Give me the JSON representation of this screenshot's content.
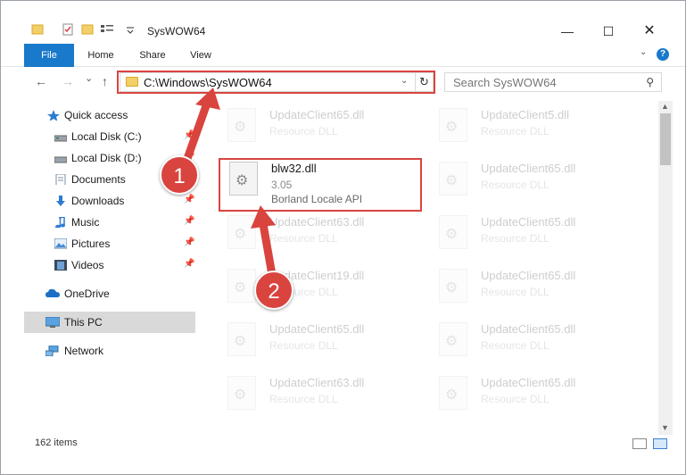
{
  "window": {
    "title": "SysWOW64",
    "minimize_glyph": "—",
    "maximize_glyph": "☐",
    "close_glyph": "✕"
  },
  "ribbon": {
    "tabs": [
      "File",
      "Home",
      "Share",
      "View"
    ],
    "help_glyph": "?"
  },
  "navigation": {
    "back_glyph": "←",
    "forward_glyph": "→",
    "recent_glyph": "⌄",
    "up_glyph": "↑",
    "address": "C:\\Windows\\SysWOW64",
    "search_placeholder": "Search SysWOW64"
  },
  "sidebar": {
    "items": [
      {
        "label": "Quick access",
        "icon": "star-icon",
        "pinned": false
      },
      {
        "label": "Local Disk (C:)",
        "icon": "drive-icon",
        "pinned": true
      },
      {
        "label": "Local Disk (D:)",
        "icon": "drive-icon",
        "pinned": true
      },
      {
        "label": "Documents",
        "icon": "documents-icon",
        "pinned": true
      },
      {
        "label": "Downloads",
        "icon": "download-icon",
        "pinned": true
      },
      {
        "label": "Music",
        "icon": "music-icon",
        "pinned": true
      },
      {
        "label": "Pictures",
        "icon": "pictures-icon",
        "pinned": true
      },
      {
        "label": "Videos",
        "icon": "videos-icon",
        "pinned": true
      },
      {
        "label": "OneDrive",
        "icon": "cloud-icon",
        "pinned": false
      },
      {
        "label": "This PC",
        "icon": "computer-icon",
        "pinned": false,
        "selected": true
      },
      {
        "label": "Network",
        "icon": "network-icon",
        "pinned": false
      }
    ]
  },
  "files": {
    "left_column": [
      {
        "name": "UpdateClient65.dll",
        "line2": "Resource DLL",
        "faded": true
      },
      {
        "name": "blw32.dll",
        "line2": "3.05",
        "line3": "Borland Locale API",
        "faded": false
      },
      {
        "name": "UpdateClient63.dll",
        "line2": "Resource DLL",
        "faded": true
      },
      {
        "name": "UpdateClient19.dll",
        "line2": "Resource DLL",
        "faded": true
      },
      {
        "name": "UpdateClient65.dll",
        "line2": "Resource DLL",
        "faded": true
      },
      {
        "name": "UpdateClient63.dll",
        "line2": "Resource DLL",
        "faded": true
      }
    ],
    "right_column": [
      {
        "name": "UpdateClient5.dll",
        "line2": "Resource DLL",
        "faded": true
      },
      {
        "name": "UpdateClient65.dll",
        "line2": "Resource DLL",
        "faded": true
      },
      {
        "name": "UpdateClient65.dll",
        "line2": "Resource DLL",
        "faded": true
      },
      {
        "name": "UpdateClient65.dll",
        "line2": "Resource DLL",
        "faded": true
      },
      {
        "name": "UpdateClient65.dll",
        "line2": "Resource DLL",
        "faded": true
      },
      {
        "name": "UpdateClient65.dll",
        "line2": "Resource DLL",
        "faded": true
      }
    ]
  },
  "status": {
    "item_count": "162 items"
  },
  "annotations": {
    "callout_1": "1",
    "callout_2": "2",
    "color": "#d9443f"
  }
}
